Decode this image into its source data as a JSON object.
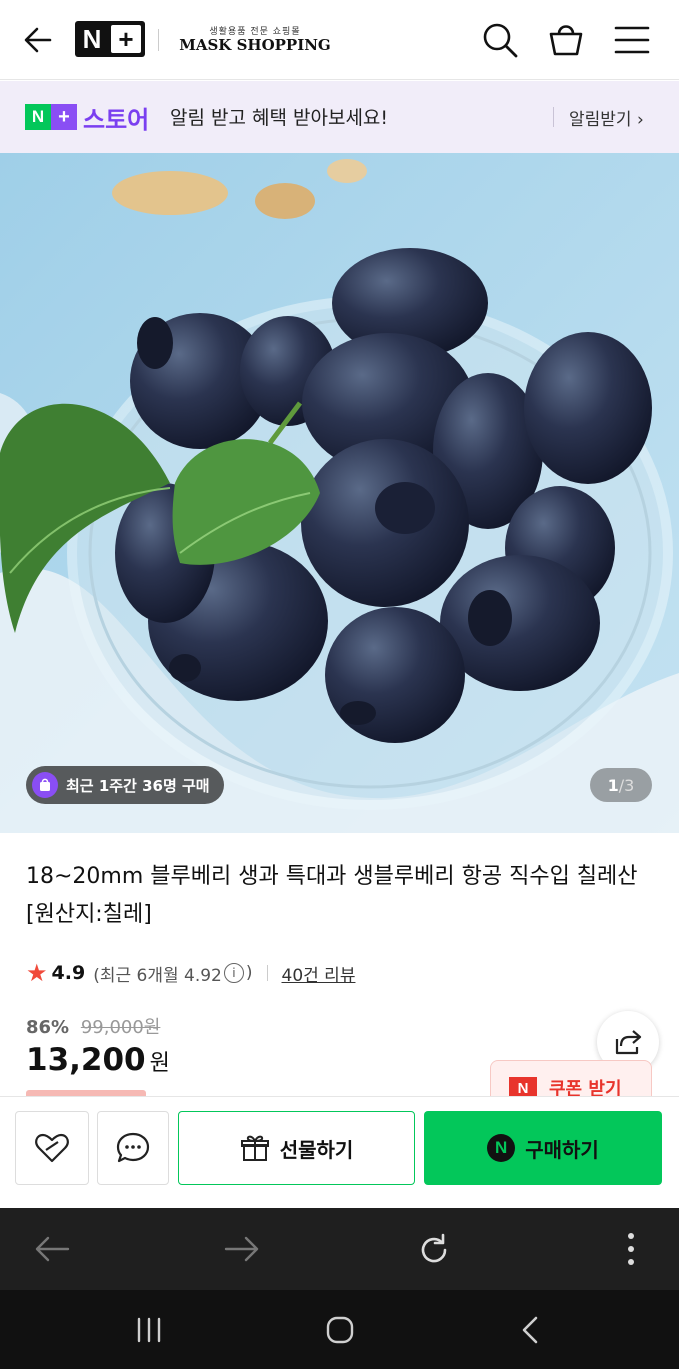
{
  "header": {
    "logo_n": "N",
    "logo_plus": "+",
    "shop_subtitle": "생활용품 전문 쇼핑몰",
    "shop_name": "MASK SHOPPING",
    "icons": [
      "back-arrow-icon",
      "search-icon",
      "shopping-bag-icon",
      "menu-icon"
    ]
  },
  "store_banner": {
    "logo_n": "N",
    "logo_plus": "+",
    "logo_text": "스토어",
    "message": "알림 받고 혜택 받아보세요!",
    "cta": "알림받기 ›"
  },
  "hero": {
    "purchase_badge": "최근 1주간 36명 구매",
    "image_index": "1",
    "image_total": "/3"
  },
  "product": {
    "title": "18~20mm 블루베리 생과 특대과 생블루베리 항공 직수입 칠레산 [원산지:칠레]",
    "rating": "4.9",
    "recent_rating_prefix": "(최근 6개월 4.92",
    "recent_rating_suffix": ")",
    "info_icon": "i",
    "review_count": "40건 리뷰",
    "discount_pct": "86%",
    "original_price": "99,000원",
    "price": "13,200",
    "price_unit": "원",
    "coupon_label": "쿠폰 받기",
    "coupon_badge": "N"
  },
  "actions": {
    "gift_label": "선물하기",
    "buy_label": "구매하기",
    "buy_badge": "N",
    "accent_color": "#03c75a"
  }
}
